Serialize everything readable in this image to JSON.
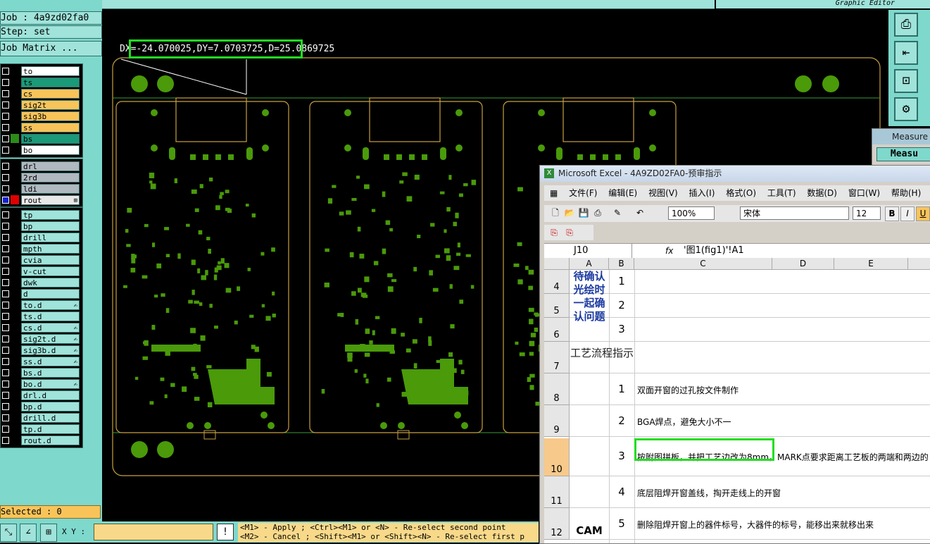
{
  "header": {
    "job": "Job : 4a9zd02fa0",
    "step": "Step: set",
    "job_matrix": "Job Matrix ...",
    "graphic_editor": "Graphic Editor"
  },
  "layers_group1": [
    {
      "name": "to",
      "color": "#ffffff",
      "on": false
    },
    {
      "name": "ts",
      "color": "#1a9a78",
      "on": false
    },
    {
      "name": "cs",
      "color": "#f8c45a",
      "on": false
    },
    {
      "name": "sig2t",
      "color": "#f8c45a",
      "on": false
    },
    {
      "name": "sig3b",
      "color": "#f8c45a",
      "on": false
    },
    {
      "name": "ss",
      "color": "#f8c45a",
      "on": false
    },
    {
      "name": "bs",
      "color": "#1a9a78",
      "on": true
    },
    {
      "name": "bo",
      "color": "#ffffff",
      "on": false
    }
  ],
  "layers_group2": [
    {
      "name": "drl",
      "color": "#b0b8c0",
      "on": false
    },
    {
      "name": "2rd",
      "color": "#b0b8c0",
      "on": false
    },
    {
      "name": "ldi",
      "color": "#b0b8c0",
      "on": false
    },
    {
      "name": "rout",
      "color": "#e8e8e8",
      "on": true,
      "mark": "⊞"
    }
  ],
  "layers_group3": [
    {
      "name": "tp",
      "mark": ""
    },
    {
      "name": "bp",
      "mark": ""
    },
    {
      "name": "drill",
      "mark": ""
    },
    {
      "name": "mpth",
      "mark": ""
    },
    {
      "name": "cvia",
      "mark": ""
    },
    {
      "name": "v-cut",
      "mark": ""
    },
    {
      "name": "dwk",
      "mark": ""
    },
    {
      "name": "d",
      "mark": ""
    },
    {
      "name": "to.d",
      "mark": "✍"
    },
    {
      "name": "ts.d",
      "mark": ""
    },
    {
      "name": "cs.d",
      "mark": "✍"
    },
    {
      "name": "sig2t.d",
      "mark": "✍"
    },
    {
      "name": "sig3b.d",
      "mark": "✍"
    },
    {
      "name": "ss.d",
      "mark": "✍"
    },
    {
      "name": "bs.d",
      "mark": ""
    },
    {
      "name": "bo.d",
      "mark": "✍"
    },
    {
      "name": "drl.d",
      "mark": ""
    },
    {
      "name": "bp.d",
      "mark": ""
    },
    {
      "name": "drill.d",
      "mark": ""
    },
    {
      "name": "tp.d",
      "mark": ""
    },
    {
      "name": "rout.d",
      "mark": ""
    }
  ],
  "selected": "Selected : 0",
  "measurement": "DX=-24.070025,DY=7.0703725,D=25.0869725",
  "bottombar": {
    "xy_label": "X Y :",
    "xy_value": "",
    "bang": "!",
    "hint1": "<M1> - Apply  ; <Ctrl><M1> or <N> - Re-select second point",
    "hint2": "<M2> - Cancel ; <Shift><M1> or <Shift><N> - Re-select first p"
  },
  "measure_window": {
    "title": "Measure",
    "button": "Measu"
  },
  "excel": {
    "title": "Microsoft Excel - 4A9ZD02FA0-预审指示",
    "menu": [
      "文件(F)",
      "编辑(E)",
      "视图(V)",
      "插入(I)",
      "格式(O)",
      "工具(T)",
      "数据(D)",
      "窗口(W)",
      "帮助(H)"
    ],
    "zoom": "100%",
    "font": "宋体",
    "font_size": "12",
    "bold": "B",
    "italic": "I",
    "underline": "U",
    "name_box": "J10",
    "fx": "fx",
    "formula": "'图1(fig1)'!A1",
    "columns": [
      "A",
      "B",
      "C",
      "D",
      "E"
    ],
    "rows": [
      {
        "row": "4",
        "num": "1",
        "text": ""
      },
      {
        "row": "5",
        "num": "2",
        "text": ""
      },
      {
        "row": "6",
        "num": "3",
        "text": ""
      },
      {
        "row": "7",
        "num": "",
        "text": ""
      },
      {
        "row": "8",
        "num": "1",
        "text": "双面开窗的过孔按文件制作"
      },
      {
        "row": "9",
        "num": "2",
        "text": "BGA焊点，避免大小不一"
      },
      {
        "row": "10",
        "num": "3",
        "text": "按附图拼板，并把工艺边改为8mm，MARK点要求距离工艺板的两端和两边的"
      },
      {
        "row": "11",
        "num": "4",
        "text": "底层阻焊开窗盖线，掏开走线上的开窗"
      },
      {
        "row": "12",
        "num": "5",
        "text": "删除阻焊开窗上的器件标号，大器件的标号，能移出来就移出来"
      }
    ],
    "merged_blue": "待确认光绘时一起确认问题",
    "merged_process": "工艺流程指示",
    "merged_cam": "CAM"
  },
  "colors": {
    "board_outline": "#c8a040",
    "pads": "#4a9a0a",
    "highlight": "#22dd22",
    "panel_bg": "#7ed8cc"
  }
}
